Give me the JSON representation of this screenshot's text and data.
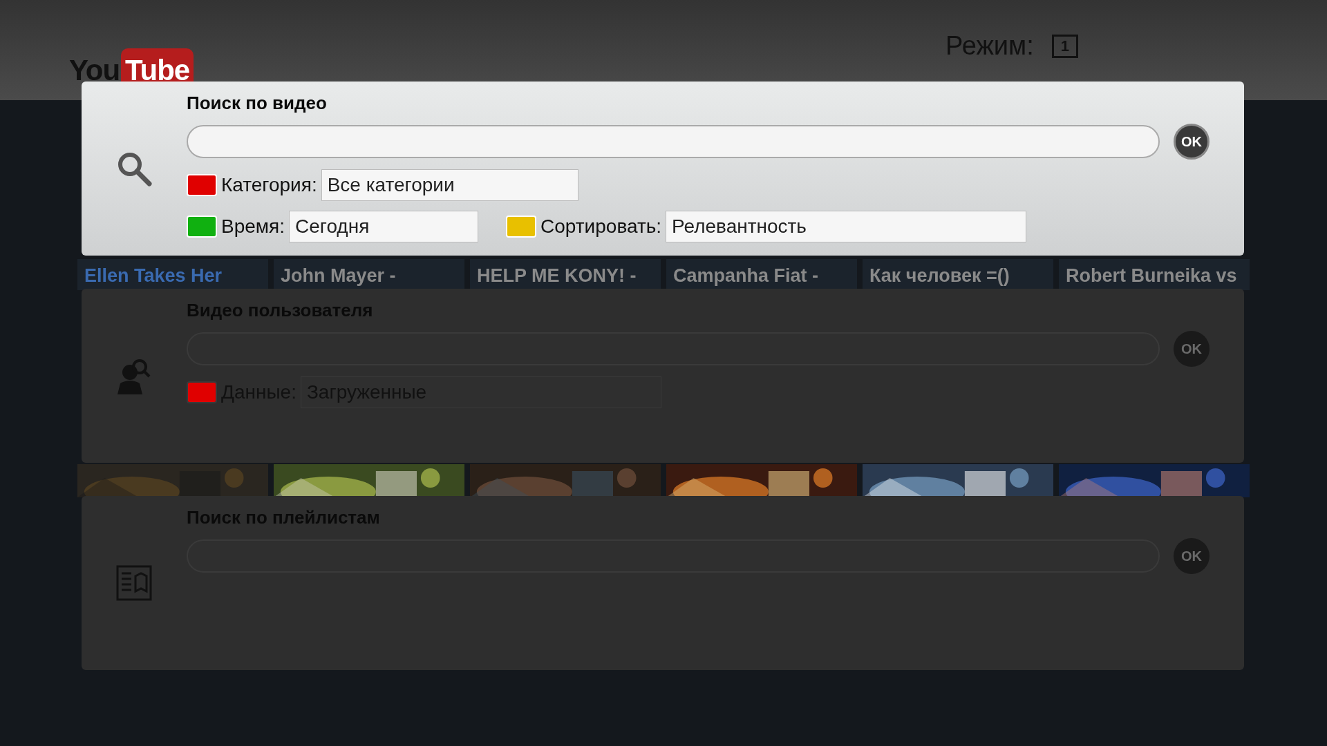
{
  "header": {
    "logo": {
      "you": "You",
      "tube": "Tube"
    },
    "mode_label": "Режим:",
    "mode_value": "1"
  },
  "videos": [
    {
      "title": "Ellen Takes Her",
      "selected": true
    },
    {
      "title": "John Mayer -",
      "selected": false
    },
    {
      "title": "HELP ME KONY! -",
      "selected": false
    },
    {
      "title": "Campanha Fiat -",
      "selected": false
    },
    {
      "title": "Как человек =()",
      "selected": false
    },
    {
      "title": "Robert Burneika vs",
      "selected": false
    }
  ],
  "sections": [
    {
      "kind": "video",
      "title": "Поиск по видео",
      "active": true,
      "ok": "OK",
      "rows": [
        [
          {
            "label": "Категория:",
            "value": "Все категории",
            "color": "#e00000"
          }
        ],
        [
          {
            "label": "Время:",
            "value": "Сегодня",
            "color": "#10b010"
          },
          {
            "label": "Сортировать:",
            "value": "Релевантность",
            "color": "#e8c000"
          }
        ]
      ]
    },
    {
      "kind": "user",
      "title": "Видео пользователя",
      "active": false,
      "ok": "OK",
      "rows": [
        [
          {
            "label": "Данные:",
            "value": "Загруженные",
            "color": "#e00000"
          }
        ]
      ]
    },
    {
      "kind": "playlist",
      "title": "Поиск по плейлистам",
      "active": false,
      "ok": "OK"
    }
  ]
}
